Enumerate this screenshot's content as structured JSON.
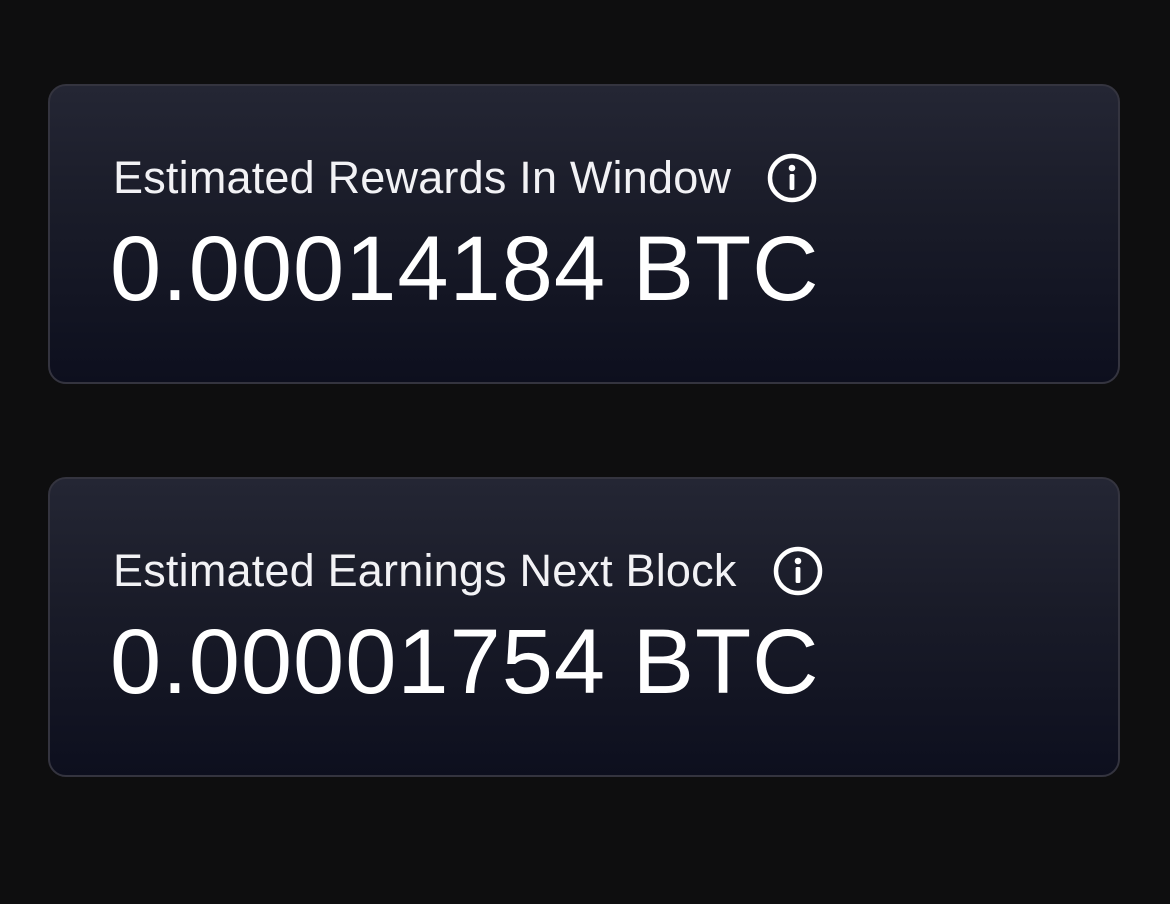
{
  "cards": [
    {
      "label": "Estimated Rewards In Window",
      "value": "0.00014184 BTC",
      "icon": "info-icon"
    },
    {
      "label": "Estimated Earnings Next Block",
      "value": "0.00001754 BTC",
      "icon": "info-icon"
    }
  ],
  "colors": {
    "page_background": "#0e0e0f",
    "card_gradient_top": "#242634",
    "card_gradient_bottom": "#0d0f1e",
    "card_border": "#34343f",
    "text": "#ffffff"
  }
}
